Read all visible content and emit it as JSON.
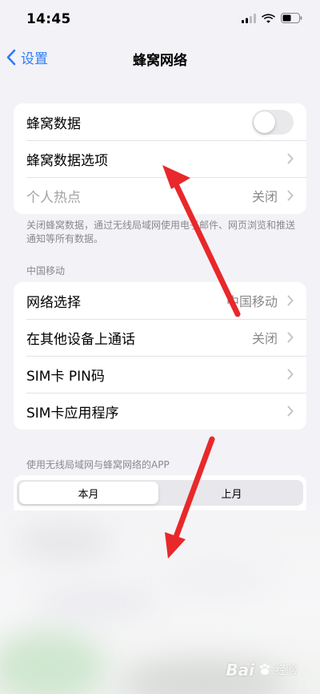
{
  "status_bar": {
    "time": "14:45"
  },
  "nav": {
    "back_label": "设置",
    "title": "蜂窝网络"
  },
  "group1": {
    "cellular_data_label": "蜂窝数据",
    "cellular_data_on": false,
    "data_options_label": "蜂窝数据选项",
    "hotspot_label": "个人热点",
    "hotspot_value": "关闭"
  },
  "group1_footer": "关闭蜂窝数据，通过无线局域网使用电子邮件、网页浏览和推送通知等所有数据。",
  "carrier_header": "中国移动",
  "group2": {
    "network_selection_label": "网络选择",
    "network_selection_value": "中国移动",
    "calls_other_devices_label": "在其他设备上通话",
    "calls_other_devices_value": "关闭",
    "sim_pin_label": "SIM卡 PIN码",
    "sim_apps_label": "SIM卡应用程序"
  },
  "apps_header": "使用无线局域网与蜂窝网络的APP",
  "segments": {
    "this_month": "本月",
    "last_month": "上月",
    "selected": "本月"
  },
  "watermark": {
    "logo": "Bai",
    "text": "经验"
  },
  "colors": {
    "accent": "#2f7cf6",
    "arrow": "#e8282a",
    "background": "#f2f2f7"
  }
}
